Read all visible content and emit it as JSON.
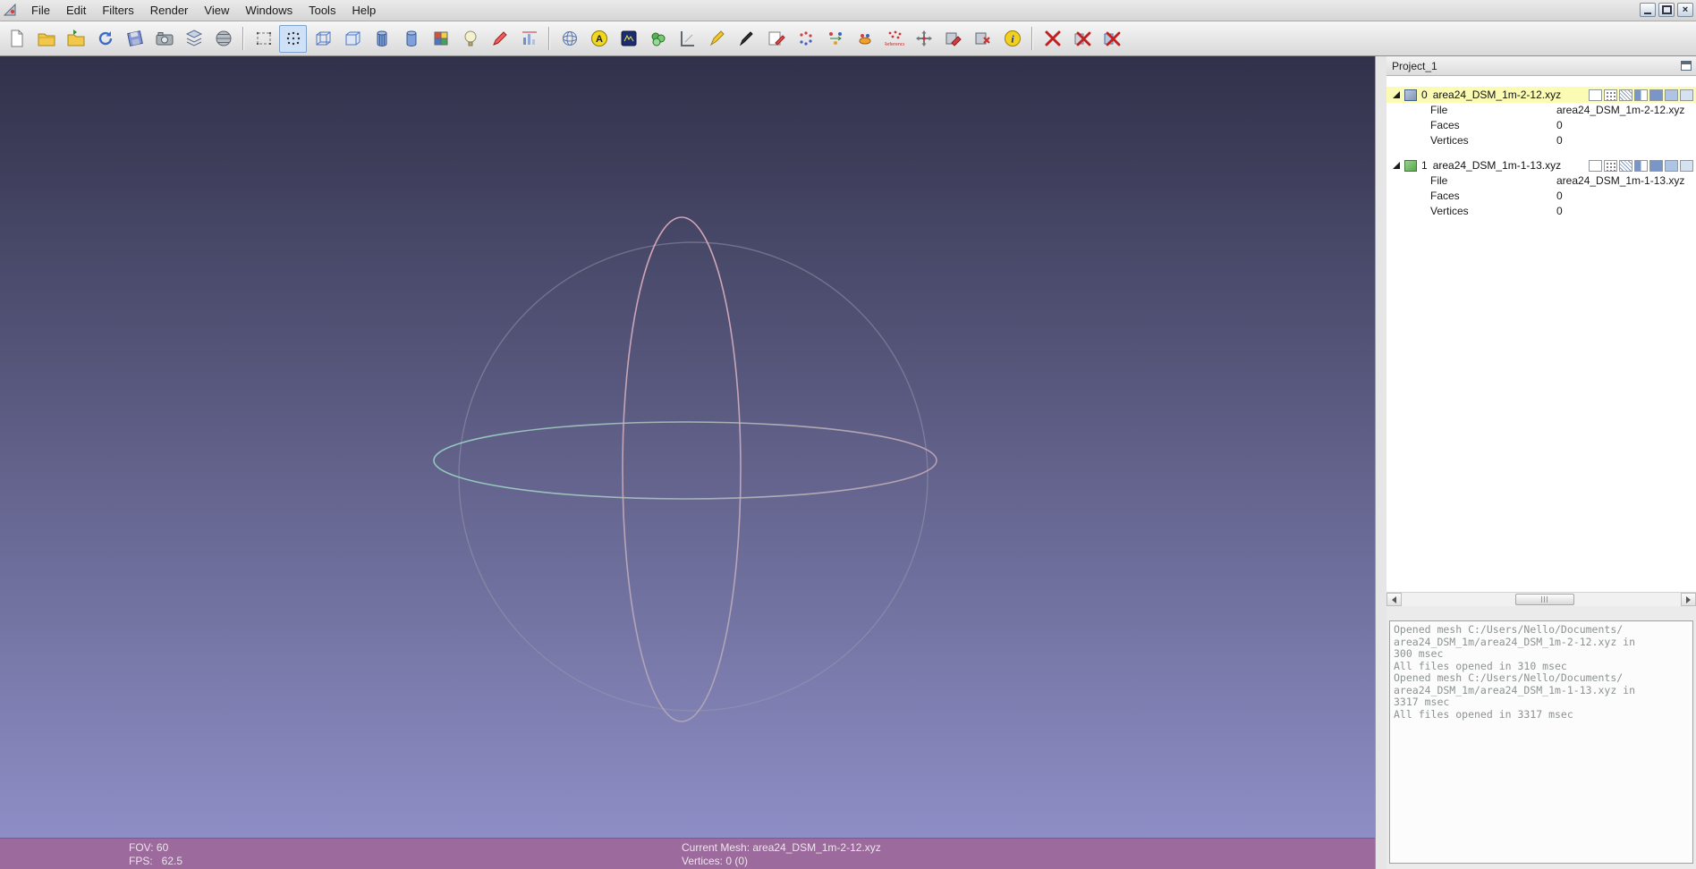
{
  "app": {
    "name": "MeshLab"
  },
  "menu": {
    "items": [
      "File",
      "Edit",
      "Filters",
      "Render",
      "View",
      "Windows",
      "Tools",
      "Help"
    ]
  },
  "window_controls": {
    "close_glyph": "×"
  },
  "toolbar": {
    "active_icon": "points-icon",
    "icons": [
      "new-document-icon",
      "open-project-icon",
      "open-mesh-icon",
      "reload-icon",
      "save-icon",
      "snapshot-icon",
      "layers-dialog-icon",
      "raster-view-icon",
      "bbox-icon",
      "points-icon",
      "wireframe-icon",
      "hidden-lines-icon",
      "flat-lines-icon",
      "flat-icon",
      "texture-icon",
      "light-icon",
      "select-edit-icon",
      "quality-histogram-icon",
      "trackball-icon",
      "ambient-occlusion-icon",
      "shader-icon",
      "splatting-icon",
      "measure-icon",
      "zpaint-icon",
      "pick-points-icon",
      "annotate-icon",
      "align-points-icon",
      "align-mesh-icon",
      "glue-icon",
      "reference-icon",
      "manipulator-icon",
      "raster-edit-icon",
      "raster-delete-icon",
      "info-icon",
      "delete-mesh-icon",
      "delete-raster-icon",
      "close-project-icon"
    ]
  },
  "project_panel": {
    "title": "Project_1",
    "layers": [
      {
        "index": "0",
        "name": "area24_DSM_1m-2-12.xyz",
        "selected": true,
        "properties": [
          {
            "label": "File",
            "value": "area24_DSM_1m-2-12.xyz"
          },
          {
            "label": "Faces",
            "value": "0"
          },
          {
            "label": "Vertices",
            "value": "0"
          }
        ]
      },
      {
        "index": "1",
        "name": "area24_DSM_1m-1-13.xyz",
        "selected": false,
        "properties": [
          {
            "label": "File",
            "value": "area24_DSM_1m-1-13.xyz"
          },
          {
            "label": "Faces",
            "value": "0"
          },
          {
            "label": "Vertices",
            "value": "0"
          }
        ]
      }
    ]
  },
  "log_console": {
    "lines": [
      "Opened mesh C:/Users/Nello/Documents/",
      "area24_DSM_1m/area24_DSM_1m-2-12.xyz in",
      "300 msec",
      "All files opened in 310 msec",
      "Opened mesh C:/Users/Nello/Documents/",
      "area24_DSM_1m/area24_DSM_1m-1-13.xyz in",
      "3317 msec",
      "All files opened in 3317 msec"
    ]
  },
  "status_bar": {
    "fov": "FOV: 60",
    "fps": "FPS:   62.5",
    "current_mesh": "Current Mesh: area24_DSM_1m-2-12.xyz",
    "vertices": "Vertices: 0 (0)"
  },
  "viewport": {
    "background_top": "#31314a",
    "background_bottom": "#8e8ec6",
    "trackball": {
      "outline_color": "#9a9ab0",
      "horizontal_ring_color": "#9adcc6",
      "vertical_ring_color": "#ecb6c6"
    }
  },
  "colors": {
    "statusbar_bg": "#9c6a9c",
    "selection_bg": "#fbfbb4"
  }
}
